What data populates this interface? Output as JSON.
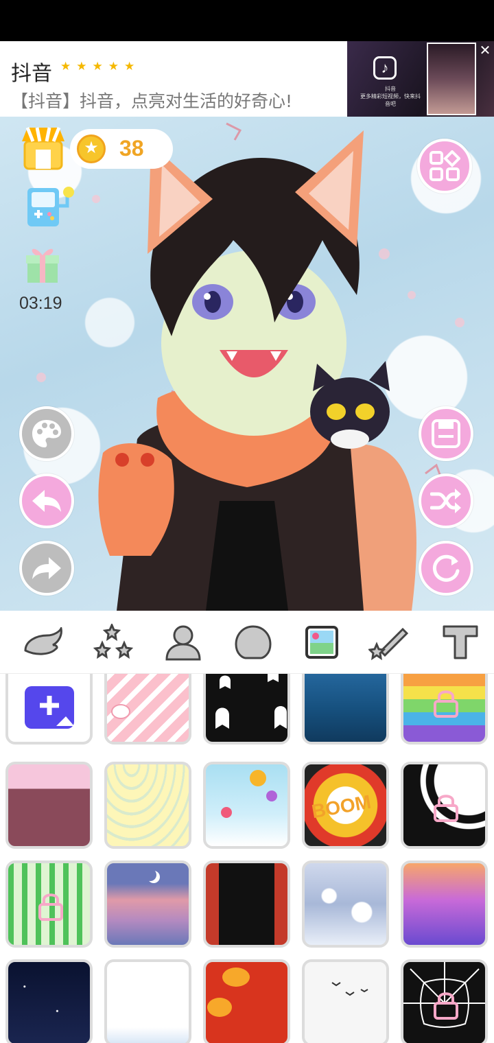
{
  "ad": {
    "title": "抖音",
    "stars": "★★★★★",
    "description": "【抖音】抖音，点亮对生活的好奇心!",
    "logo_glyph": "♪",
    "media_caption": "抖音",
    "media_text": "更多精彩短视频，快来抖音吧",
    "close_glyph": "✕"
  },
  "hud": {
    "coins": "38",
    "timer": "03:19",
    "coin_glyph": "★"
  },
  "icons": {
    "shop": "shop-icon",
    "game": "game-console-icon",
    "gift": "gift-icon",
    "palette": "palette-icon",
    "undo": "undo-icon",
    "redo": "redo-icon",
    "apps": "apps-grid-icon",
    "save": "save-icon",
    "shuffle": "shuffle-icon",
    "reset": "refresh-icon"
  },
  "toolbar": {
    "tabs": [
      "wings",
      "sparkles",
      "person",
      "bubble",
      "background",
      "pencil",
      "text"
    ],
    "selected_tab": "background"
  },
  "colors": {
    "accent_pink": "#f4a9dd",
    "coin_gold": "#f0a524",
    "disabled_grey": "#bdbdbd"
  },
  "backgrounds": [
    {
      "name": "upload-custom",
      "locked": false
    },
    {
      "name": "pink-stripes",
      "locked": false
    },
    {
      "name": "ghosts",
      "locked": false
    },
    {
      "name": "underwater",
      "locked": false
    },
    {
      "name": "rainbow",
      "locked": true
    },
    {
      "name": "pink-tree",
      "locked": false
    },
    {
      "name": "yellow-waves",
      "locked": false
    },
    {
      "name": "balloons-clouds",
      "locked": false
    },
    {
      "name": "boom-comic",
      "locked": false
    },
    {
      "name": "swirl-dark",
      "locked": true
    },
    {
      "name": "bamboo",
      "locked": true
    },
    {
      "name": "night-clouds",
      "locked": false
    },
    {
      "name": "stage-curtain",
      "locked": false
    },
    {
      "name": "bokeh-blue",
      "locked": false
    },
    {
      "name": "purple-sparkle",
      "locked": false
    },
    {
      "name": "starry-night",
      "locked": false
    },
    {
      "name": "white-waves",
      "locked": false
    },
    {
      "name": "red-lanterns",
      "locked": false
    },
    {
      "name": "birds-sky",
      "locked": false
    },
    {
      "name": "spiderweb",
      "locked": true
    }
  ]
}
